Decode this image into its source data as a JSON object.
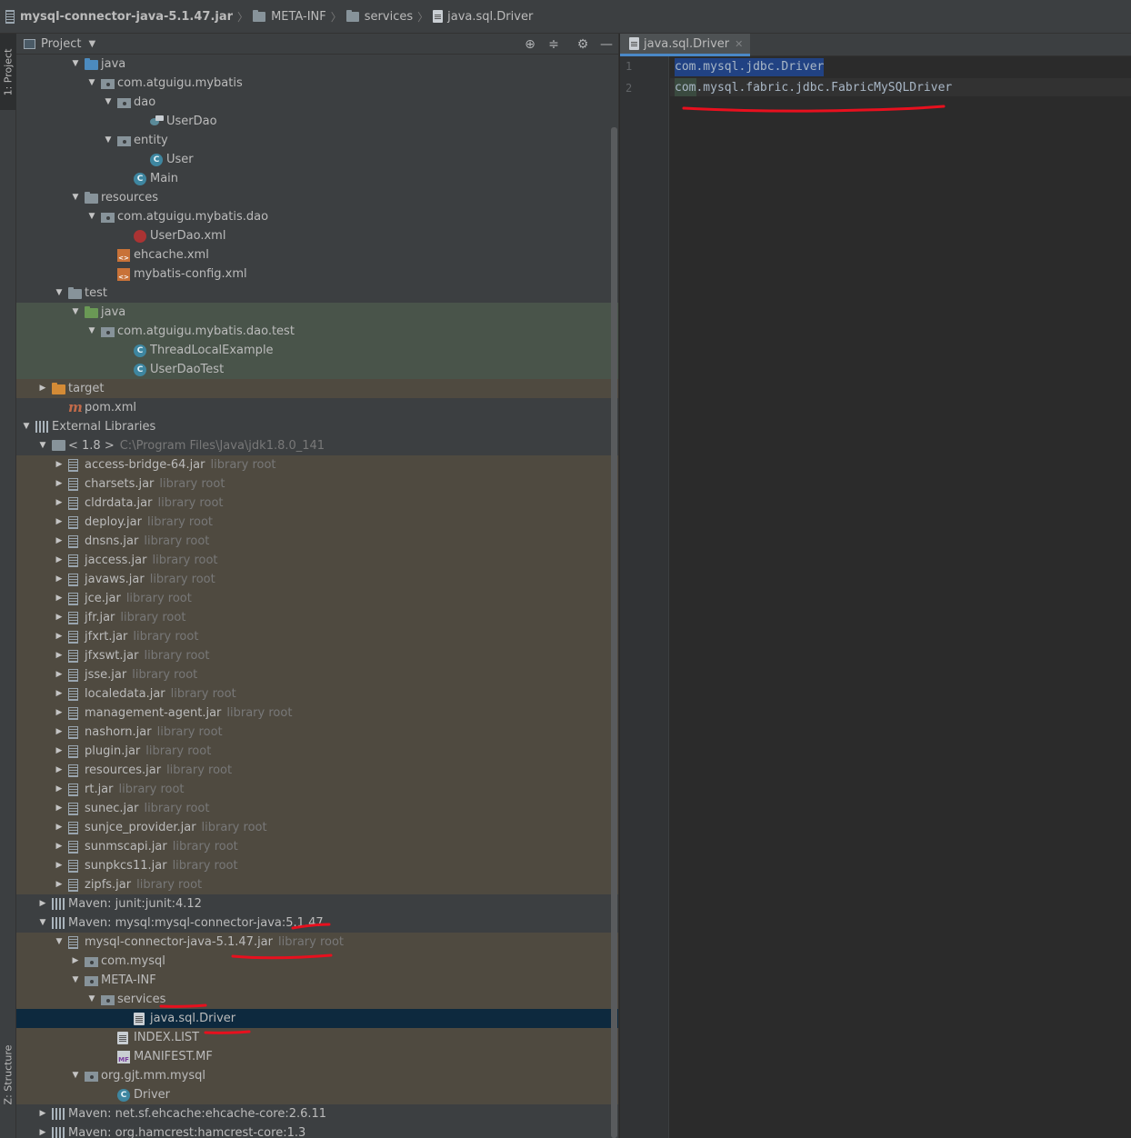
{
  "breadcrumb": {
    "items": [
      {
        "label": "mysql-connector-java-5.1.47.jar",
        "icon": "jar-icon"
      },
      {
        "label": "META-INF",
        "icon": "folder-icon"
      },
      {
        "label": "services",
        "icon": "folder-icon"
      },
      {
        "label": "java.sql.Driver",
        "icon": "text-file-icon"
      }
    ]
  },
  "left_strip": {
    "project_tab": "1: Project",
    "structure_tab": "Z: Structure"
  },
  "project_panel": {
    "title": "Project",
    "dropdown_icon": "chevron-down-icon",
    "tools": [
      "locate-icon",
      "collapse-all-icon",
      "gear-icon",
      "hide-icon"
    ]
  },
  "tree": [
    {
      "label": "java",
      "icon": "source-folder-icon",
      "arrow": "open",
      "depth": 3,
      "bg": "none"
    },
    {
      "label": "com.atguigu.mybatis",
      "icon": "package-icon",
      "arrow": "open",
      "depth": 4,
      "bg": "none"
    },
    {
      "label": "dao",
      "icon": "package-icon",
      "arrow": "open",
      "depth": 5,
      "bg": "none"
    },
    {
      "label": "UserDao",
      "icon": "interface-icon",
      "arrow": "",
      "depth": 7,
      "bg": "none"
    },
    {
      "label": "entity",
      "icon": "package-icon",
      "arrow": "open",
      "depth": 5,
      "bg": "none"
    },
    {
      "label": "User",
      "icon": "class-icon",
      "arrow": "",
      "depth": 7,
      "bg": "none"
    },
    {
      "label": "Main",
      "icon": "class-icon",
      "arrow": "",
      "depth": 6,
      "bg": "none"
    },
    {
      "label": "resources",
      "icon": "resources-folder-icon",
      "arrow": "open",
      "depth": 3,
      "bg": "none"
    },
    {
      "label": "com.atguigu.mybatis.dao",
      "icon": "package-icon",
      "arrow": "open",
      "depth": 4,
      "bg": "none"
    },
    {
      "label": "UserDao.xml",
      "icon": "mybatis-xml-icon",
      "arrow": "",
      "depth": 6,
      "bg": "none"
    },
    {
      "label": "ehcache.xml",
      "icon": "xml-icon",
      "arrow": "",
      "depth": 5,
      "bg": "none"
    },
    {
      "label": "mybatis-config.xml",
      "icon": "xml-icon",
      "arrow": "",
      "depth": 5,
      "bg": "none"
    },
    {
      "label": "test",
      "icon": "folder-icon",
      "arrow": "open",
      "depth": 2,
      "bg": "none"
    },
    {
      "label": "java",
      "icon": "test-source-folder-icon",
      "arrow": "open",
      "depth": 3,
      "bg": "test"
    },
    {
      "label": "com.atguigu.mybatis.dao.test",
      "icon": "package-icon",
      "arrow": "open",
      "depth": 4,
      "bg": "test"
    },
    {
      "label": "ThreadLocalExample",
      "icon": "class-icon",
      "arrow": "",
      "depth": 6,
      "bg": "test"
    },
    {
      "label": "UserDaoTest",
      "icon": "class-icon",
      "arrow": "",
      "depth": 6,
      "bg": "test"
    },
    {
      "label": "target",
      "icon": "excluded-folder-icon",
      "arrow": "closed",
      "depth": 1,
      "bg": "excluded"
    },
    {
      "label": "pom.xml",
      "icon": "maven-icon",
      "arrow": "",
      "depth": 2,
      "bg": "none"
    },
    {
      "label": "External Libraries",
      "icon": "libraries-icon",
      "arrow": "open",
      "depth": 0,
      "bg": "none"
    },
    {
      "label": "< 1.8 >",
      "suffix": "C:\\Program Files\\Java\\jdk1.8.0_141",
      "icon": "jdk-icon",
      "arrow": "open",
      "depth": 1,
      "bg": "none"
    },
    {
      "label": "access-bridge-64.jar",
      "suffix": "library root",
      "icon": "jar-icon",
      "arrow": "closed",
      "depth": 2,
      "bg": "excluded"
    },
    {
      "label": "charsets.jar",
      "suffix": "library root",
      "icon": "jar-icon",
      "arrow": "closed",
      "depth": 2,
      "bg": "excluded"
    },
    {
      "label": "cldrdata.jar",
      "suffix": "library root",
      "icon": "jar-icon",
      "arrow": "closed",
      "depth": 2,
      "bg": "excluded"
    },
    {
      "label": "deploy.jar",
      "suffix": "library root",
      "icon": "jar-icon",
      "arrow": "closed",
      "depth": 2,
      "bg": "excluded"
    },
    {
      "label": "dnsns.jar",
      "suffix": "library root",
      "icon": "jar-icon",
      "arrow": "closed",
      "depth": 2,
      "bg": "excluded"
    },
    {
      "label": "jaccess.jar",
      "suffix": "library root",
      "icon": "jar-icon",
      "arrow": "closed",
      "depth": 2,
      "bg": "excluded"
    },
    {
      "label": "javaws.jar",
      "suffix": "library root",
      "icon": "jar-icon",
      "arrow": "closed",
      "depth": 2,
      "bg": "excluded"
    },
    {
      "label": "jce.jar",
      "suffix": "library root",
      "icon": "jar-icon",
      "arrow": "closed",
      "depth": 2,
      "bg": "excluded"
    },
    {
      "label": "jfr.jar",
      "suffix": "library root",
      "icon": "jar-icon",
      "arrow": "closed",
      "depth": 2,
      "bg": "excluded"
    },
    {
      "label": "jfxrt.jar",
      "suffix": "library root",
      "icon": "jar-icon",
      "arrow": "closed",
      "depth": 2,
      "bg": "excluded"
    },
    {
      "label": "jfxswt.jar",
      "suffix": "library root",
      "icon": "jar-icon",
      "arrow": "closed",
      "depth": 2,
      "bg": "excluded"
    },
    {
      "label": "jsse.jar",
      "suffix": "library root",
      "icon": "jar-icon",
      "arrow": "closed",
      "depth": 2,
      "bg": "excluded"
    },
    {
      "label": "localedata.jar",
      "suffix": "library root",
      "icon": "jar-icon",
      "arrow": "closed",
      "depth": 2,
      "bg": "excluded"
    },
    {
      "label": "management-agent.jar",
      "suffix": "library root",
      "icon": "jar-icon",
      "arrow": "closed",
      "depth": 2,
      "bg": "excluded"
    },
    {
      "label": "nashorn.jar",
      "suffix": "library root",
      "icon": "jar-icon",
      "arrow": "closed",
      "depth": 2,
      "bg": "excluded"
    },
    {
      "label": "plugin.jar",
      "suffix": "library root",
      "icon": "jar-icon",
      "arrow": "closed",
      "depth": 2,
      "bg": "excluded"
    },
    {
      "label": "resources.jar",
      "suffix": "library root",
      "icon": "jar-icon",
      "arrow": "closed",
      "depth": 2,
      "bg": "excluded"
    },
    {
      "label": "rt.jar",
      "suffix": "library root",
      "icon": "jar-icon",
      "arrow": "closed",
      "depth": 2,
      "bg": "excluded"
    },
    {
      "label": "sunec.jar",
      "suffix": "library root",
      "icon": "jar-icon",
      "arrow": "closed",
      "depth": 2,
      "bg": "excluded"
    },
    {
      "label": "sunjce_provider.jar",
      "suffix": "library root",
      "icon": "jar-icon",
      "arrow": "closed",
      "depth": 2,
      "bg": "excluded"
    },
    {
      "label": "sunmscapi.jar",
      "suffix": "library root",
      "icon": "jar-icon",
      "arrow": "closed",
      "depth": 2,
      "bg": "excluded"
    },
    {
      "label": "sunpkcs11.jar",
      "suffix": "library root",
      "icon": "jar-icon",
      "arrow": "closed",
      "depth": 2,
      "bg": "excluded"
    },
    {
      "label": "zipfs.jar",
      "suffix": "library root",
      "icon": "jar-icon",
      "arrow": "closed",
      "depth": 2,
      "bg": "excluded"
    },
    {
      "label": "Maven: junit:junit:4.12",
      "icon": "maven-library-icon",
      "arrow": "closed",
      "depth": 1,
      "bg": "none"
    },
    {
      "label": "Maven: mysql:mysql-connector-java:5.1.47",
      "icon": "maven-library-icon",
      "arrow": "open",
      "depth": 1,
      "bg": "none"
    },
    {
      "label": "mysql-connector-java-5.1.47.jar",
      "suffix": "library root",
      "icon": "jar-icon",
      "arrow": "open",
      "depth": 2,
      "bg": "excluded"
    },
    {
      "label": "com.mysql",
      "icon": "package-icon",
      "arrow": "closed",
      "depth": 3,
      "bg": "excluded"
    },
    {
      "label": "META-INF",
      "icon": "package-icon",
      "arrow": "open",
      "depth": 3,
      "bg": "excluded"
    },
    {
      "label": "services",
      "icon": "package-icon",
      "arrow": "open",
      "depth": 4,
      "bg": "excluded"
    },
    {
      "label": "java.sql.Driver",
      "icon": "text-file-icon",
      "arrow": "",
      "depth": 6,
      "bg": "selected"
    },
    {
      "label": "INDEX.LIST",
      "icon": "text-file-icon",
      "arrow": "",
      "depth": 5,
      "bg": "excluded"
    },
    {
      "label": "MANIFEST.MF",
      "icon": "manifest-icon",
      "arrow": "",
      "depth": 5,
      "bg": "excluded"
    },
    {
      "label": "org.gjt.mm.mysql",
      "icon": "package-icon",
      "arrow": "open",
      "depth": 3,
      "bg": "excluded"
    },
    {
      "label": "Driver",
      "icon": "class-icon",
      "arrow": "",
      "depth": 5,
      "bg": "excluded"
    },
    {
      "label": "Maven: net.sf.ehcache:ehcache-core:2.6.11",
      "icon": "maven-library-icon",
      "arrow": "closed",
      "depth": 1,
      "bg": "none"
    },
    {
      "label": "Maven: org.hamcrest:hamcrest-core:1.3",
      "icon": "maven-library-icon",
      "arrow": "closed",
      "depth": 1,
      "bg": "none"
    }
  ],
  "editor": {
    "tab_label": "java.sql.Driver",
    "tab_icon": "text-file-icon",
    "close_icon": "close-icon",
    "lines": [
      {
        "number": "1",
        "text": "com.mysql.jdbc.Driver"
      },
      {
        "number": "2",
        "text": "com.mysql.fabric.jdbc.FabricMySQLDriver"
      }
    ]
  },
  "colors": {
    "annotation": "#e8101e",
    "selection": "#0d293e",
    "test_bg": "#49544a",
    "library_bg": "#4f4a40"
  }
}
